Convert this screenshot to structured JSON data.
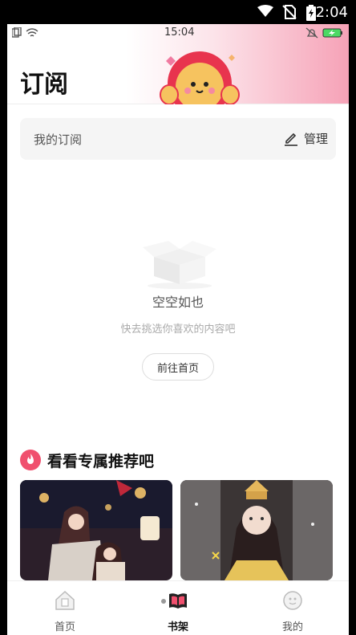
{
  "android_status": {
    "time": "2:04"
  },
  "inner_status": {
    "time": "15:04"
  },
  "header": {
    "title": "订阅"
  },
  "subscription_bar": {
    "label": "我的订阅",
    "manage_label": "管理"
  },
  "empty_state": {
    "title": "空空如也",
    "subtitle": "快去挑选你喜欢的内容吧",
    "button_label": "前往首页"
  },
  "recommend": {
    "title": "看看专属推荐吧"
  },
  "tabs": [
    {
      "label": "首页",
      "icon": "home-icon"
    },
    {
      "label": "书架",
      "icon": "bookshelf-icon",
      "active": true
    },
    {
      "label": "我的",
      "icon": "profile-icon"
    }
  ],
  "colors": {
    "accent": "#f0506e",
    "header_pink": "#f6a2b7",
    "battery_green": "#4cd964"
  }
}
